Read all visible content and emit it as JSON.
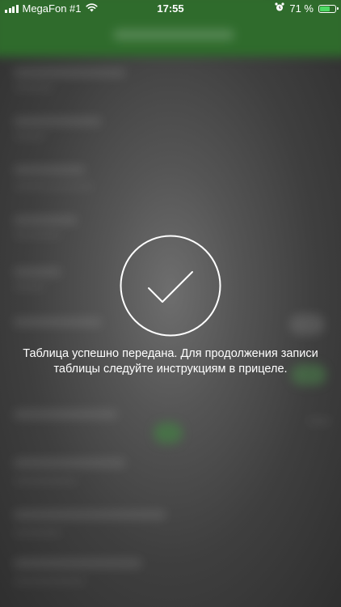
{
  "status_bar": {
    "carrier": "MegaFon #1",
    "time": "17:55",
    "battery_percent": "71 %",
    "battery_level": 0.71,
    "signal_bars": 4
  },
  "overlay": {
    "message": "Таблица успешно передана. Для продолжения записи таблицы следуйте инструкциям в прицеле."
  },
  "colors": {
    "header_green": "#2f6b2c",
    "battery_green": "#4cd964",
    "overlay_text": "#ffffff"
  }
}
